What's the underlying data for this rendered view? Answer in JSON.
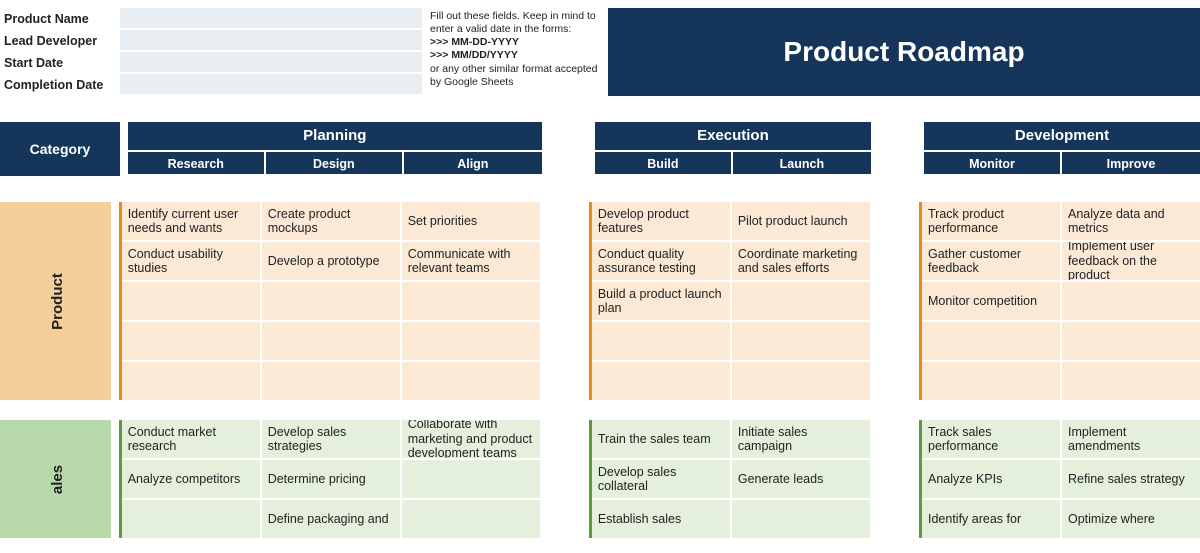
{
  "meta": {
    "labels": {
      "product_name": "Product Name",
      "lead_developer": "Lead Developer",
      "start_date": "Start Date",
      "completion_date": "Completion Date"
    },
    "values": {
      "product_name": "",
      "lead_developer": "",
      "start_date": "",
      "completion_date": ""
    },
    "help_line1": "Fill out these fields. Keep in mind to enter a valid date in the forms:",
    "help_fmt1": ">>> MM-DD-YYYY",
    "help_fmt2": ">>> MM/DD/YYYY",
    "help_line2": "or any other similar format accepted by Google Sheets"
  },
  "title": "Product Roadmap",
  "headers": {
    "category": "Category",
    "phases": {
      "planning": {
        "title": "Planning",
        "subs": [
          "Research",
          "Design",
          "Align"
        ]
      },
      "execution": {
        "title": "Execution",
        "subs": [
          "Build",
          "Launch"
        ]
      },
      "development": {
        "title": "Development",
        "subs": [
          "Monitor",
          "Improve"
        ]
      }
    }
  },
  "swimlanes": {
    "product": {
      "label": "Product",
      "planning": [
        [
          "Identify current user needs and wants",
          "Create product mockups",
          "Set priorities"
        ],
        [
          "Conduct usability studies",
          "Develop a prototype",
          "Communicate with relevant teams"
        ],
        [
          "",
          "",
          ""
        ],
        [
          "",
          "",
          ""
        ],
        [
          "",
          "",
          ""
        ]
      ],
      "execution": [
        [
          "Develop product features",
          "Pilot product launch"
        ],
        [
          "Conduct quality assurance testing",
          "Coordinate marketing and sales efforts"
        ],
        [
          "Build a product launch plan",
          ""
        ],
        [
          "",
          ""
        ],
        [
          "",
          ""
        ]
      ],
      "development": [
        [
          "Track product performance",
          "Analyze data and metrics"
        ],
        [
          "Gather customer feedback",
          "Implement user feedback on the product"
        ],
        [
          "Monitor competition",
          ""
        ],
        [
          "",
          ""
        ],
        [
          "",
          ""
        ]
      ]
    },
    "sales": {
      "label": "ales",
      "planning": [
        [
          "Conduct market research",
          "Develop sales strategies",
          "Collaborate with marketing and product development teams"
        ],
        [
          "Analyze competitors",
          "Determine pricing",
          ""
        ],
        [
          "",
          "Define packaging and",
          ""
        ]
      ],
      "execution": [
        [
          "Train the sales team",
          "Initiate sales campaign"
        ],
        [
          "Develop sales collateral",
          "Generate leads"
        ],
        [
          "Establish sales",
          ""
        ]
      ],
      "development": [
        [
          "Track sales performance",
          "Implement amendments"
        ],
        [
          "Analyze KPIs",
          "Refine sales strategy"
        ],
        [
          "Identify areas for",
          "Optimize where"
        ]
      ]
    }
  }
}
